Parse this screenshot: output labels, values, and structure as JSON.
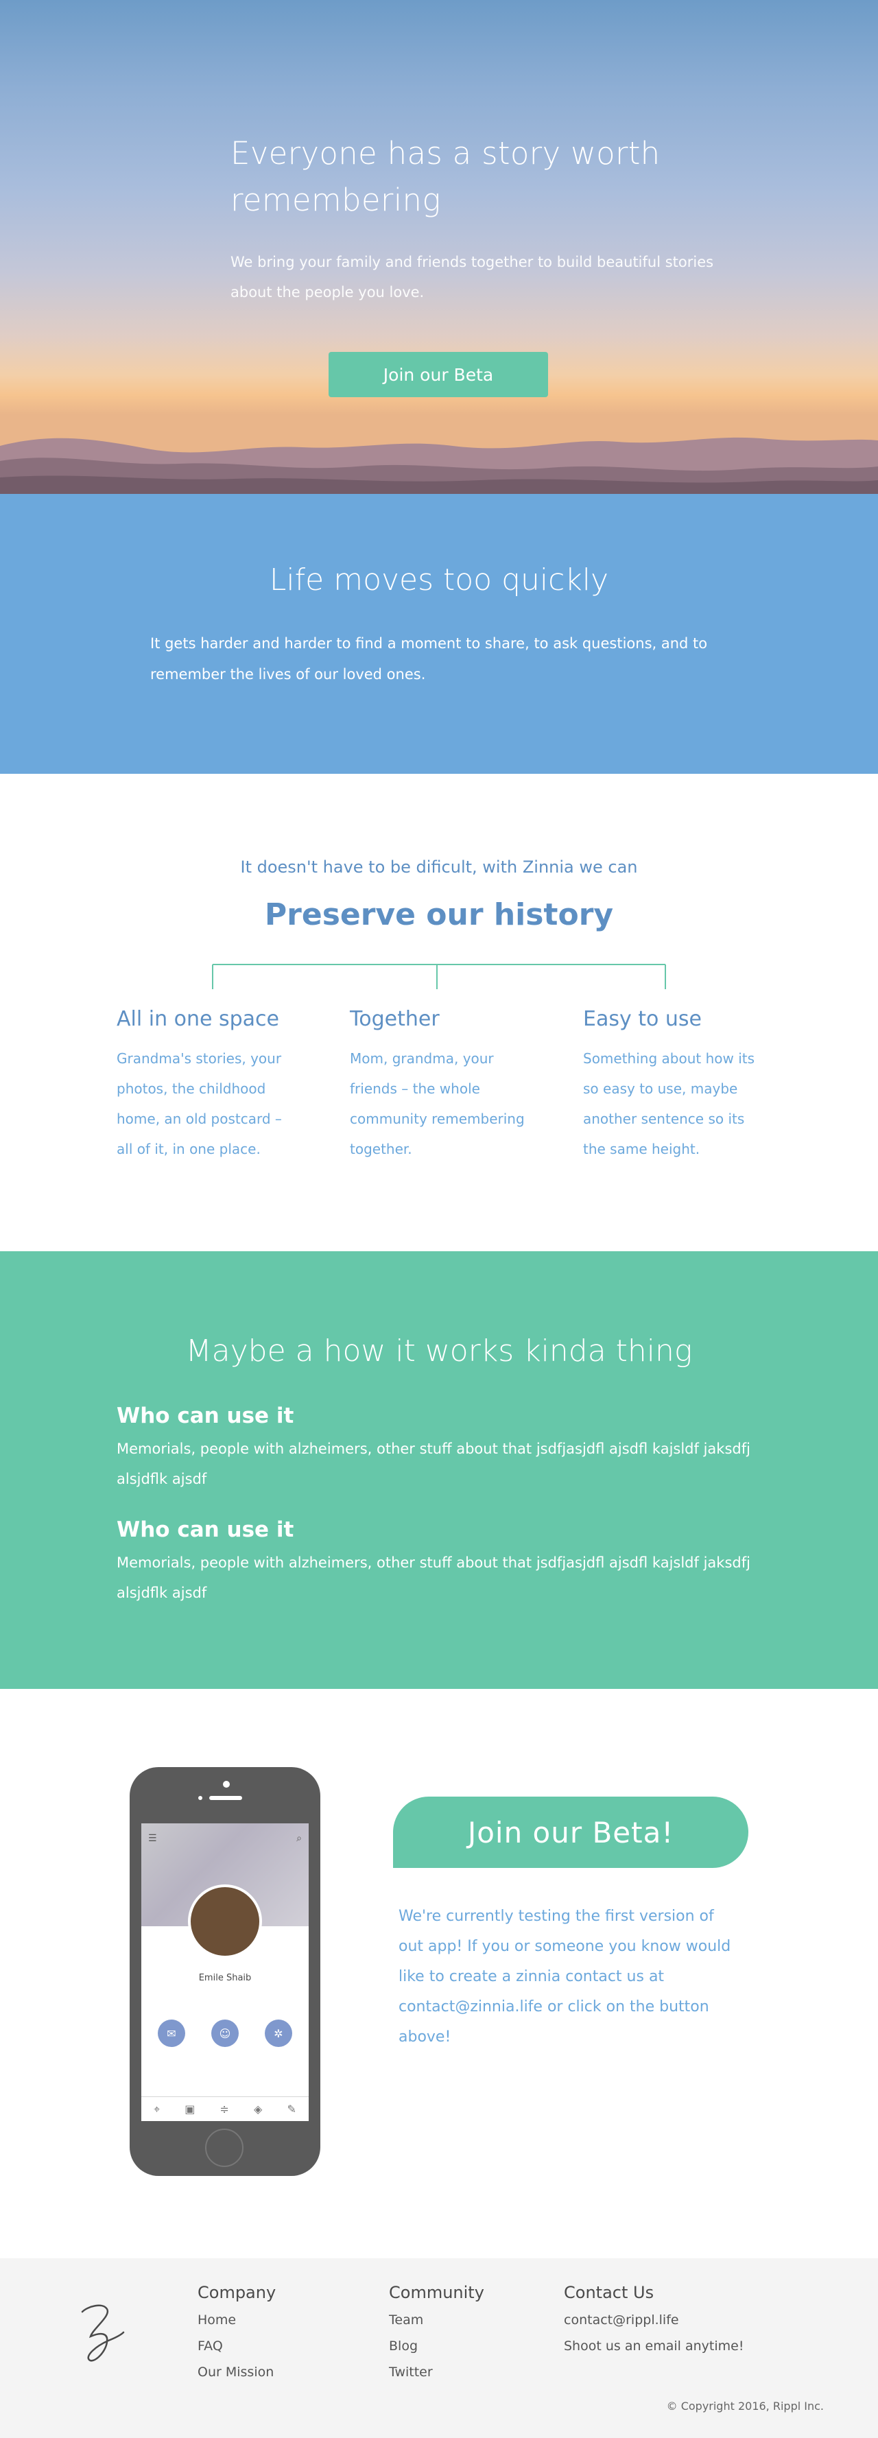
{
  "hero": {
    "title": "Everyone has a story worth remembering",
    "subtitle": "We bring your family and friends together to build beautiful stories about the people you love.",
    "cta_label": "Join our Beta"
  },
  "life": {
    "title": "Life moves too quickly",
    "body": "It gets harder and harder to find a moment to share, to ask questions, and to remember the lives of our loved ones."
  },
  "preserve": {
    "kicker": "It doesn't have to be dificult, with Zinnia we can",
    "title": "Preserve our history",
    "features": [
      {
        "title": "All in one space",
        "body": "Grandma's stories, your photos, the childhood home, an old postcard – all of it, in one place."
      },
      {
        "title": "Together",
        "body": "Mom, grandma, your friends – the whole community remembering together."
      },
      {
        "title": "Easy to use",
        "body": "Something about how its so easy to use, maybe another sentence so its the same height."
      }
    ]
  },
  "how": {
    "title": "Maybe a how it works kinda thing",
    "items": [
      {
        "heading": "Who can use it",
        "body": "Memorials, people with alzheimers, other stuff about that jsdfjasjdfl ajsdfl kajsldf jaksdfj alsjdflk ajsdf"
      },
      {
        "heading": "Who can use it",
        "body": "Memorials, people with alzheimers, other stuff about that jsdfjasjdfl ajsdfl kajsldf jaksdfj alsjdflk ajsdf"
      }
    ]
  },
  "beta": {
    "cta_label": "Join our Beta!",
    "body": "We're currently testing the first version of out app!  If you or someone you know would like to create a zinnia contact us at contact@zinnia.life or click on the button above!",
    "phone": {
      "profile_name": "Emile Shaib",
      "icons": [
        "chat-icon",
        "people-icon",
        "settings-icon"
      ],
      "tab_icons": [
        "location-icon",
        "box-icon",
        "timeline-icon",
        "layers-icon",
        "edit-icon"
      ]
    }
  },
  "footer": {
    "company": {
      "heading": "Company",
      "links": [
        "Home",
        "FAQ",
        "Our Mission"
      ]
    },
    "community": {
      "heading": "Community",
      "links": [
        "Team",
        "Blog",
        "Twitter"
      ]
    },
    "contact": {
      "heading": "Contact Us",
      "email": "contact@rippl.life",
      "note": "Shoot us an email anytime!"
    },
    "copyright": "© Copyright 2016, Rippl Inc."
  },
  "colors": {
    "accent_green": "#66c7a9",
    "accent_blue": "#6ca8dc",
    "heading_blue": "#5d8fc3"
  }
}
